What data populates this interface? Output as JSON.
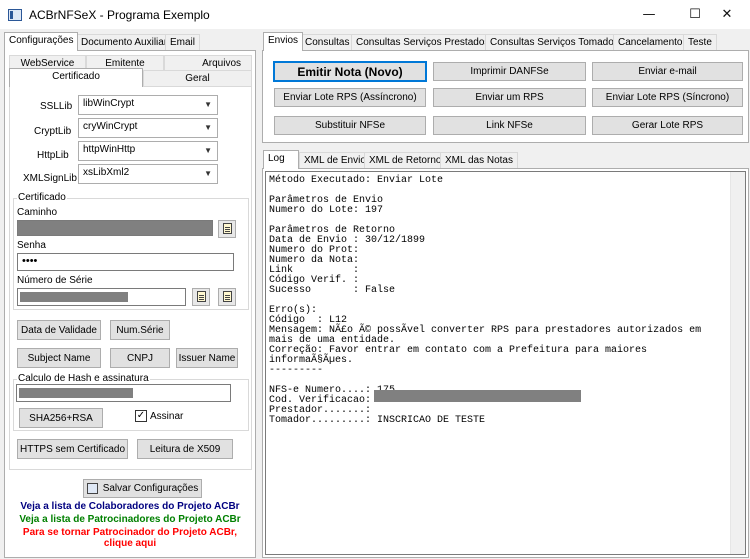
{
  "window": {
    "title": "ACBrNFSeX - Programa Exemplo",
    "minimize": "—",
    "maximize": "☐",
    "close": "✕"
  },
  "left_tabs": [
    "Configurações",
    "Documento Auxiliar",
    "Email"
  ],
  "sub_tabs_row1": [
    "WebService",
    "Emitente",
    "Arquivos"
  ],
  "sub_tabs_row2": [
    "Certificado",
    "Geral"
  ],
  "libs": [
    {
      "label": "SSLLib",
      "value": "libWinCrypt"
    },
    {
      "label": "CryptLib",
      "value": "cryWinCrypt"
    },
    {
      "label": "HttpLib",
      "value": "httpWinHttp"
    },
    {
      "label": "XMLSignLib",
      "value": "xsLibXml2"
    }
  ],
  "certificado": {
    "group_label": "Certificado",
    "caminho_label": "Caminho",
    "senha_label": "Senha",
    "senha_value": "••••",
    "serie_label": "Número de Série"
  },
  "buttons": {
    "data_validade": "Data de Validade",
    "num_serie": "Num.Série",
    "subject_name": "Subject Name",
    "cnpj": "CNPJ",
    "issuer_name": "Issuer Name",
    "sha256": "SHA256+RSA",
    "assinar": "Assinar",
    "https_sem_cert": "HTTPS sem Certificado",
    "leitura_x509": "Leitura de X509",
    "salvar": "Salvar Configurações"
  },
  "hash_group_label": "Calculo de Hash e assinatura",
  "links": {
    "colaboradores": "Veja a lista de Colaboradores do Projeto ACBr",
    "patrocinadores": "Veja a lista de Patrocinadores do Projeto ACBr",
    "patrocinador_line1": "Para se tornar Patrocinador do Projeto ACBr,",
    "patrocinador_line2": "clique aqui"
  },
  "colors": {
    "colaboradores": "#000080",
    "patrocinadores": "#008000",
    "patrocinador": "#ff0000",
    "primary_border": "#0078d7"
  },
  "right_tabs": [
    "Envios",
    "Consultas",
    "Consultas Serviços Prestados",
    "Consultas Serviços Tomados",
    "Cancelamento",
    "Teste"
  ],
  "actions": [
    "Emitir Nota (Novo)",
    "Imprimir DANFSe",
    "Enviar e-mail",
    "Enviar Lote RPS (Assíncrono)",
    "Enviar um RPS",
    "Enviar Lote RPS (Síncrono)",
    "Substituir NFSe",
    "Link NFSe",
    "Gerar Lote RPS"
  ],
  "log_tabs": [
    "Log",
    "XML de Envio",
    "XML de Retorno",
    "XML das Notas"
  ],
  "log_lines": [
    "Método Executado: Enviar Lote",
    "",
    "Parâmetros de Envio",
    "Numero do Lote: 197",
    "",
    "Parâmetros de Retorno",
    "Data de Envio : 30/12/1899",
    "Numero do Prot:",
    "Numero da Nota:",
    "Link          :",
    "Código Verif. :",
    "Sucesso       : False",
    "",
    "Erro(s):",
    "Código  : L12",
    "Mensagem: NÃ£o Ã© possÃ­vel converter RPS para prestadores autorizados em",
    "mais de uma entidade.",
    "Correção: Favor entrar em contato com a Prefeitura para maiores",
    "informaÃ§Ãµes.",
    "---------",
    "",
    "NFS-e Numero....: 175",
    "Cod. Verificacao:",
    "Prestador.......:",
    "Tomador.........: INSCRICAO DE TESTE"
  ]
}
